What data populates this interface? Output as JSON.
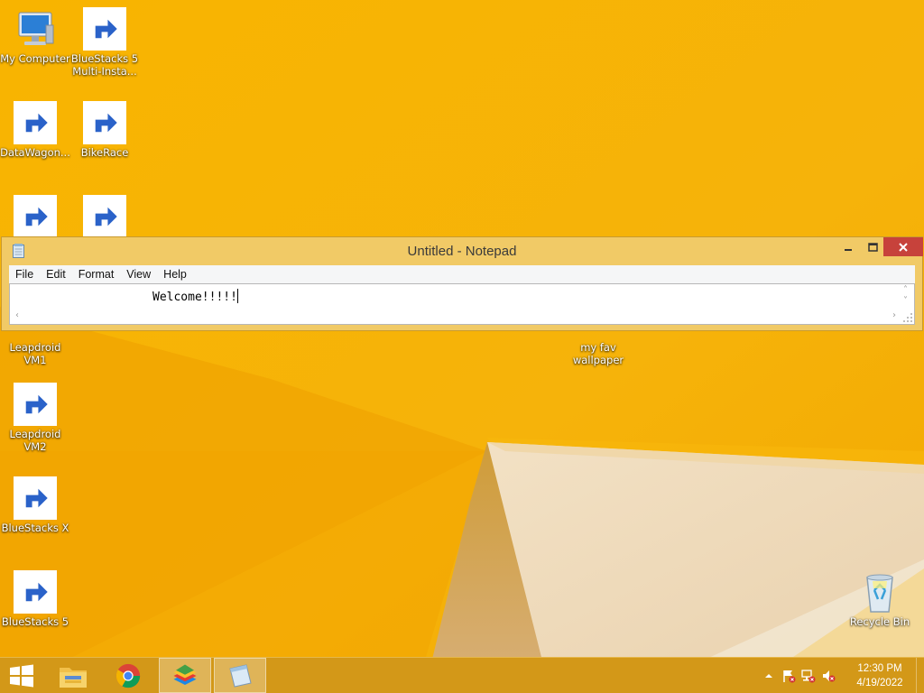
{
  "desktop": {
    "background_color": "#f7b500",
    "icons": [
      {
        "label": "My Computer",
        "icon": "computer-icon"
      },
      {
        "label": "BlueStacks 5\nMulti-Insta...",
        "icon": "bluestacks-multi-instance-icon"
      },
      {
        "label": "DataWagon...",
        "icon": "datawagon-icon"
      },
      {
        "label": "BikeRace",
        "icon": "bikerace-icon"
      },
      {
        "label": "",
        "icon": "chrome-icon"
      },
      {
        "label": "",
        "icon": "subway-surfers-icon"
      },
      {
        "label": "Leapdroid\nVM1",
        "icon": "leapdroid-icon"
      },
      {
        "label": "my fav\nwallpaper",
        "icon": "wallpaper-file-icon"
      },
      {
        "label": "Leapdroid\nVM2",
        "icon": "leapdroid-icon"
      },
      {
        "label": "BlueStacks X",
        "icon": "bluestacks-x-icon"
      },
      {
        "label": "BlueStacks 5",
        "icon": "bluestacks-icon"
      },
      {
        "label": "Recycle Bin",
        "icon": "recycle-bin-icon"
      }
    ]
  },
  "notepad": {
    "title": "Untitled - Notepad",
    "menu": [
      "File",
      "Edit",
      "Format",
      "View",
      "Help"
    ],
    "content": "Welcome!!!!!",
    "controls": {
      "minimize": "minimize-icon",
      "maximize": "maximize-icon",
      "close": "close-icon"
    },
    "close_color": "#c7423b"
  },
  "taskbar": {
    "buttons": [
      {
        "icon": "windows-start-icon",
        "active": false
      },
      {
        "icon": "file-explorer-icon",
        "active": false
      },
      {
        "icon": "chrome-icon",
        "active": false
      },
      {
        "icon": "bluestacks-icon",
        "active": true
      },
      {
        "icon": "notepad-icon",
        "active": true
      }
    ],
    "tray": [
      "show-hidden-icons-icon",
      "action-center-flag-icon",
      "network-icon",
      "volume-muted-icon"
    ],
    "time": "12:30 PM",
    "date": "4/19/2022"
  }
}
